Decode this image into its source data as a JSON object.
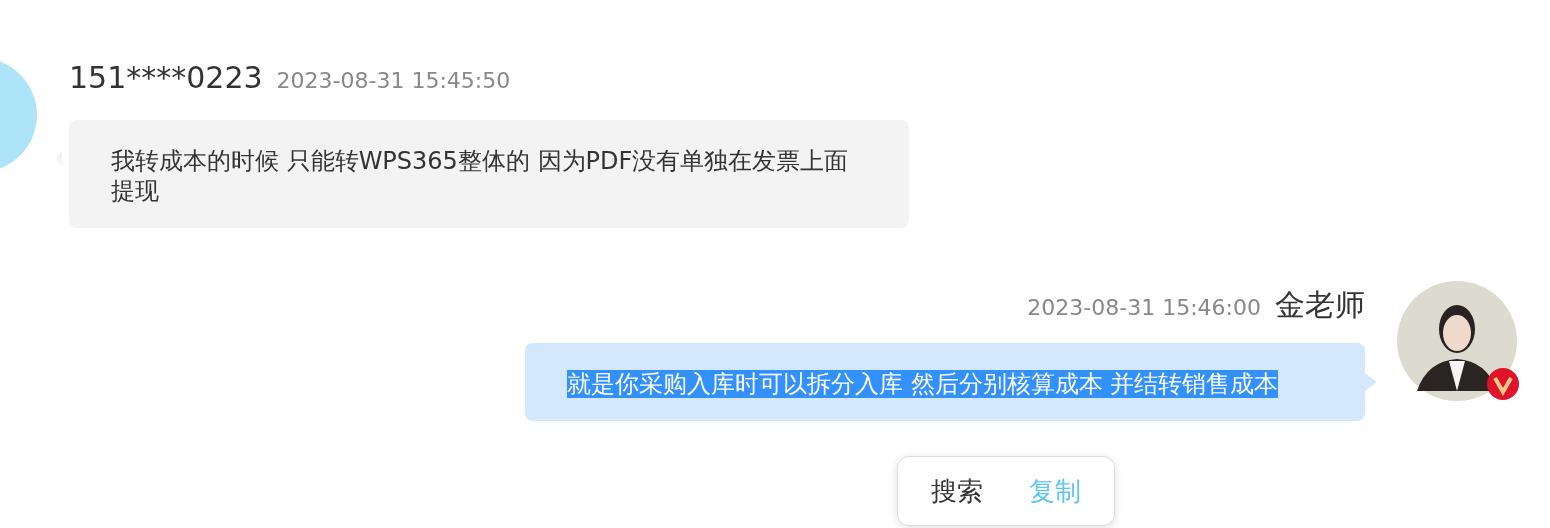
{
  "messages": [
    {
      "kind": "incoming",
      "sender": "151****0223",
      "time": "2023-08-31 15:45:50",
      "text": "我转成本的时候 只能转WPS365整体的 因为PDF没有单独在发票上面提现",
      "selected": false,
      "verified": false
    },
    {
      "kind": "outgoing",
      "sender": "金老师",
      "time": "2023-08-31 15:46:00",
      "text": "就是你采购入库时可以拆分入库 然后分别核算成本 并结转销售成本",
      "selected": true,
      "verified": true
    }
  ],
  "context_menu": [
    {
      "label": "搜索",
      "color": "#333333"
    },
    {
      "label": "复制",
      "color": "#5fc5f5"
    }
  ]
}
